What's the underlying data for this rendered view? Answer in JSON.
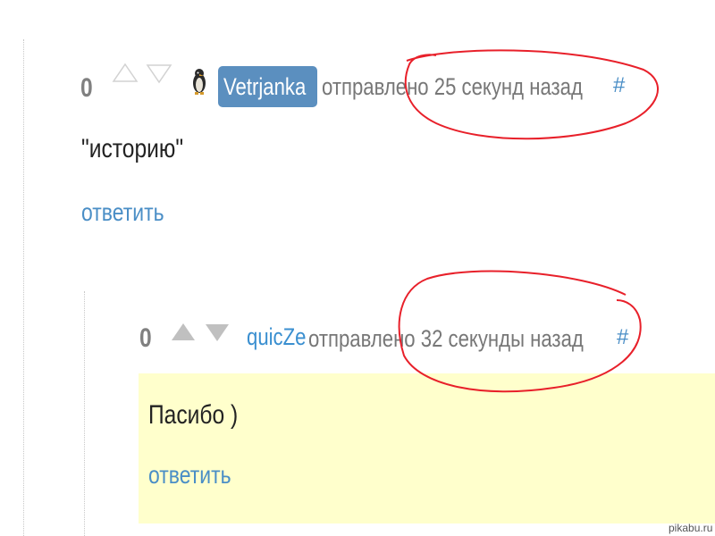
{
  "comments": [
    {
      "score": "0",
      "username": "Vetrjanka",
      "posted_text": "отправлено 25 секунд назад",
      "permalink": "#",
      "body": "\"историю\"",
      "reply_label": "ответить",
      "avatar_icon": "penguin-icon"
    },
    {
      "score": "0",
      "username": "quicZe",
      "posted_text": "отправлено 32 секунды назад",
      "permalink": "#",
      "body": "Пасибо )",
      "reply_label": "ответить"
    }
  ],
  "watermark": "pikabu.ru",
  "colors": {
    "score": "#808080",
    "meta": "#777777",
    "link": "#4a8ec6",
    "username_badge_bg": "#5b8fbf",
    "username_link": "#3a8fd0",
    "highlight_bg": "#ffffcc",
    "annotation_circle": "#e8202a"
  }
}
